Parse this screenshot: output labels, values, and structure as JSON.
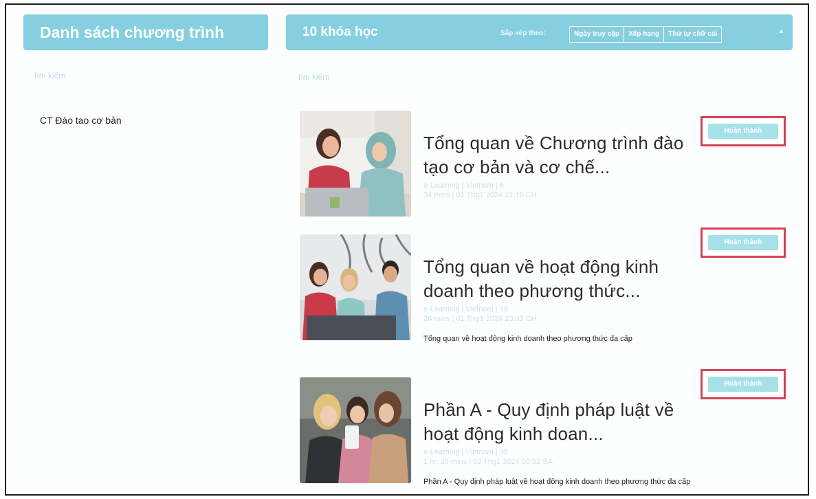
{
  "left_panel": {
    "title": "Danh sách chương trình",
    "search_placeholder": "tìm kiếm",
    "programs": [
      "CT Đào tao cơ bản"
    ]
  },
  "right_panel": {
    "course_count": "10 khóa học",
    "sort_label": "Sắp xếp theo:",
    "sort_options": [
      "Ngày truy cập",
      "Xếp hạng",
      "Thứ tự chữ cái"
    ],
    "sort_caret": "▲",
    "search_placeholder": "tìm kiếm"
  },
  "courses": [
    {
      "title": "Tổng quan về Chương trình đào tạo cơ bản và cơ chế...",
      "meta_line1": "e-Learning | Vietnam | 6",
      "meta_line2": "34 mins | 01 Thg1 2024 21:10 CH",
      "description": "",
      "status": "Hoàn thành"
    },
    {
      "title": "Tổng quan về hoạt động kinh doanh theo phương thức...",
      "meta_line1": "e-Learning | Vietnam | 19",
      "meta_line2": "26 mins | 01 Thg1 2024 23:33 CH",
      "description": "Tổng quan về hoạt động kinh doanh theo phương thức đa cấp",
      "status": "Hoàn thành"
    },
    {
      "title": "Phần A - Quy định pháp luật về hoạt động kinh doan...",
      "meta_line1": "e-Learning | Vietnam | 35",
      "meta_line2": "1 hr, 35 mins | 02 Thg1 2024 00:02 SA",
      "description": "Phần A - Quy định pháp luật về hoạt động kinh doanh theo phương thức đa cấp",
      "status": "Hoàn thành"
    }
  ],
  "colors": {
    "header_bg": "#85cfe0",
    "status_bg": "#a6e1ea",
    "highlight_border": "#d44158"
  }
}
